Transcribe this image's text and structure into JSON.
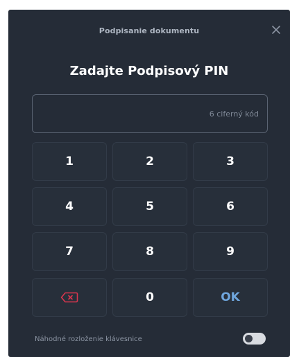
{
  "dialog": {
    "title": "Podpisanie dokumentu",
    "close_icon": "close-icon"
  },
  "heading": "Zadajte Podpisový PIN",
  "pin_input": {
    "value": "",
    "placeholder": "6 ciferný kód"
  },
  "keypad": {
    "keys": [
      "1",
      "2",
      "3",
      "4",
      "5",
      "6",
      "7",
      "8",
      "9",
      "0"
    ],
    "backspace_icon": "backspace-icon",
    "ok_label": "OK"
  },
  "footer": {
    "random_layout_label": "Náhodné rozloženie klávesnice",
    "random_layout_enabled": false
  },
  "colors": {
    "dialog_bg": "#252c37",
    "key_bg": "#272f3a",
    "key_border": "#323b48",
    "ok_accent": "#6fa6dd",
    "backspace_accent": "#d9364e"
  }
}
